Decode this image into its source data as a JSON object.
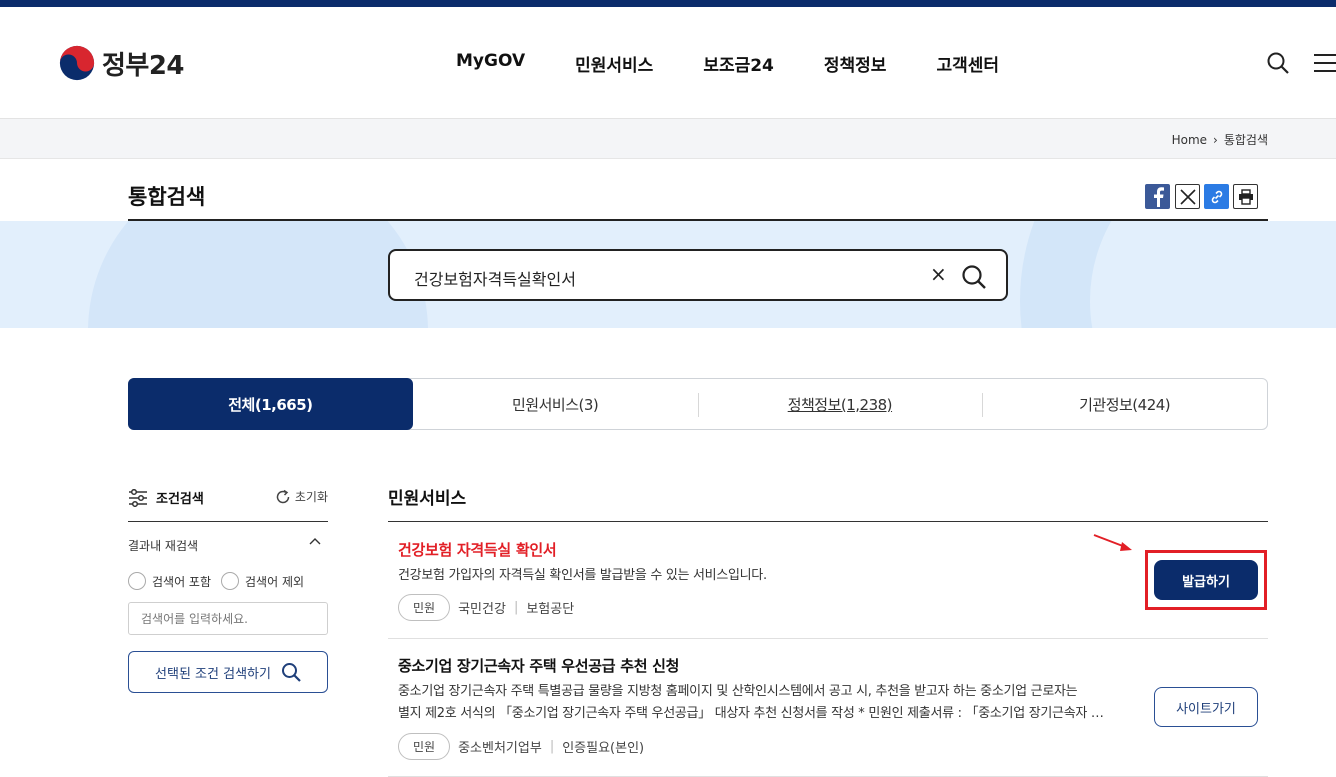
{
  "header": {
    "logo_text": "정부24",
    "nav": [
      "MyGOV",
      "민원서비스",
      "보조금24",
      "정책정보",
      "고객센터"
    ]
  },
  "breadcrumb": {
    "home": "Home",
    "current": "통합검색"
  },
  "page": {
    "title": "통합검색"
  },
  "search": {
    "value": "건강보험자격득실확인서",
    "clear": "×"
  },
  "tabs": [
    {
      "label": "전체(1,665)",
      "active": true
    },
    {
      "label": "민원서비스(3)",
      "active": false
    },
    {
      "label": "정책정보(1,238)",
      "active": false
    },
    {
      "label": "기관정보(424)",
      "active": false
    }
  ],
  "sidebar": {
    "title": "조건검색",
    "reset": "초기화",
    "refine": "결과내 재검색",
    "include": "검색어 포함",
    "exclude": "검색어 제외",
    "placeholder": "검색어를 입력하세요.",
    "apply": "선택된 조건 검색하기"
  },
  "results": {
    "heading": "민원서비스",
    "items": [
      {
        "title": "건강보험 자격득실 확인서",
        "title_color": "#e21f26",
        "desc1": "건강보험 가입자의 자격득실 확인서를 발급받을 수 있는 서비스입니다.",
        "desc2": "",
        "tag": "민원",
        "org": "국민건강",
        "org2": "보험공단",
        "button": "발급하기"
      },
      {
        "title": "중소기업 장기근속자 주택 우선공급 추천 신청",
        "title_color": "#111111",
        "desc1": "중소기업 장기근속자 주택 특별공급 물량을 지방청 홈페이지 및 산학인시스템에서 공고 시, 추천을 받고자 하는 중소기업 근로자는",
        "desc2": "별지 제2호 서식의 「중소기업 장기근속자 주택 우선공급」 대상자 추천 신청서를 작성 * 민원인 제출서류 : 「중소기업 장기근속자 …",
        "tag": "민원",
        "org": "중소벤처기업부",
        "org2": "인증필요(본인)",
        "button": "사이트가기"
      }
    ]
  },
  "colors": {
    "brand": "#0b2c6b",
    "highlight": "#e21f26"
  }
}
